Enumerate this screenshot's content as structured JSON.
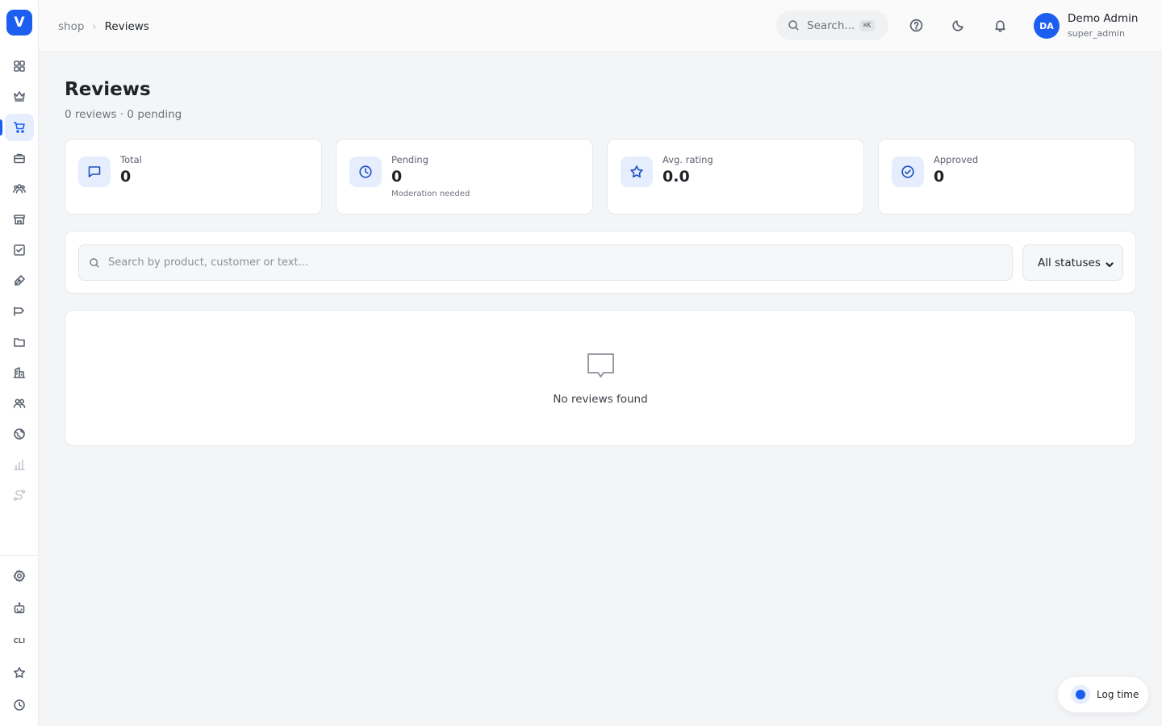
{
  "brand": {
    "logo_letter": "V",
    "accent": "#1b5ef0"
  },
  "sidebar": {
    "items": [
      {
        "name": "dashboard",
        "icon": "grid-icon",
        "active": false
      },
      {
        "name": "crown",
        "icon": "crown-icon",
        "active": false
      },
      {
        "name": "shop",
        "icon": "cart-icon",
        "active": true
      },
      {
        "name": "products",
        "icon": "briefcase-icon",
        "active": false
      },
      {
        "name": "users",
        "icon": "users-icon",
        "active": false
      },
      {
        "name": "store",
        "icon": "store-icon",
        "active": false
      },
      {
        "name": "tasks",
        "icon": "checkbox-icon",
        "active": false
      },
      {
        "name": "editor",
        "icon": "pen-icon",
        "active": false
      },
      {
        "name": "campaigns",
        "icon": "megaphone-icon",
        "active": false
      },
      {
        "name": "files",
        "icon": "folder-icon",
        "active": false
      },
      {
        "name": "buildings",
        "icon": "building-icon",
        "active": false
      },
      {
        "name": "teams",
        "icon": "team-icon",
        "active": false
      },
      {
        "name": "globe",
        "icon": "globe-icon",
        "active": false
      },
      {
        "name": "analytics",
        "icon": "bar-chart-icon",
        "active": false
      },
      {
        "name": "integrations",
        "icon": "route-icon",
        "active": false
      }
    ],
    "bottom": [
      {
        "name": "settings",
        "icon": "gear-icon"
      },
      {
        "name": "bot",
        "icon": "robot-icon"
      },
      {
        "name": "cli",
        "label": "CLI"
      },
      {
        "name": "favorites",
        "icon": "star-icon"
      },
      {
        "name": "history",
        "icon": "clock-icon"
      }
    ]
  },
  "header": {
    "breadcrumb": {
      "parent": "shop",
      "separator": "›",
      "current": "Reviews"
    },
    "search": {
      "label": "Search...",
      "shortcut": "⌘K"
    },
    "user": {
      "initials": "DA",
      "name": "Demo Admin",
      "role": "super_admin"
    }
  },
  "page": {
    "title": "Reviews",
    "subtitle": "0 reviews · 0 pending"
  },
  "stats": [
    {
      "label": "Total",
      "value": "0",
      "icon": "message-square-icon"
    },
    {
      "label": "Pending",
      "value": "0",
      "note": "Moderation needed",
      "icon": "clock-icon"
    },
    {
      "label": "Avg. rating",
      "value": "0.0",
      "icon": "star-icon"
    },
    {
      "label": "Approved",
      "value": "0",
      "icon": "check-circle-icon"
    }
  ],
  "filters": {
    "search_placeholder": "Search by product, customer or text...",
    "search_value": "",
    "status_selected": "All statuses"
  },
  "empty_state": {
    "text": "No reviews found",
    "icon": "message-square-icon"
  },
  "log_time": {
    "label": "Log time"
  }
}
